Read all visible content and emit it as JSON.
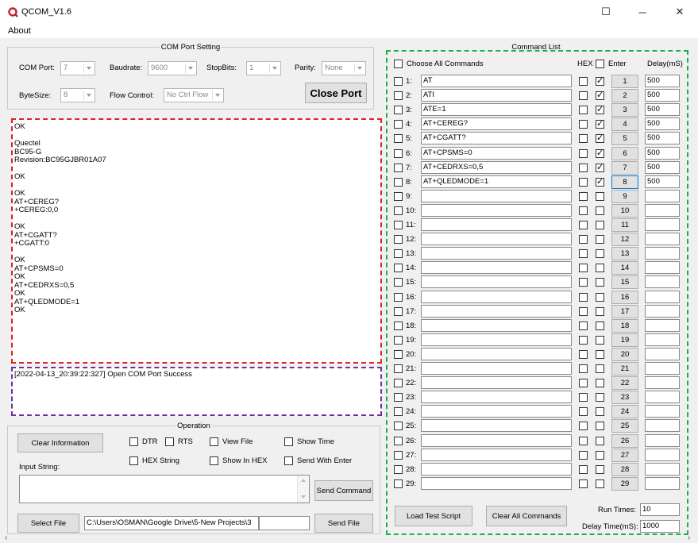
{
  "window": {
    "title": "QCOM_V1.6",
    "minimize": "─",
    "maximize": "☐",
    "close": "✕"
  },
  "menu": {
    "about": "About"
  },
  "com_port": {
    "legend": "COM Port Setting",
    "com_port_label": "COM Port:",
    "com_port_value": "7",
    "baudrate_label": "Baudrate:",
    "baudrate_value": "9600",
    "stopbits_label": "StopBits:",
    "stopbits_value": "1",
    "parity_label": "Parity:",
    "parity_value": "None",
    "bytesize_label": "ByteSize:",
    "bytesize_value": "8",
    "flow_label": "Flow Control:",
    "flow_value": "No Ctrl Flow",
    "close_port": "Close Port"
  },
  "receive_log": "OK\n\nQuectel\nBC95-G\nRevision:BC95GJBR01A07\n\nOK\n\nOK\nAT+CEREG?\n+CEREG:0,0\n\nOK\nAT+CGATT?\n+CGATT:0\n\nOK\nAT+CPSMS=0\nOK\nAT+CEDRXS=0,5\nOK\nAT+QLEDMODE=1\nOK",
  "status_log": "[2022-04-13_20:39:22:327] Open COM Port Success",
  "operation": {
    "legend": "Operation",
    "clear_info": "Clear Information",
    "dtr": "DTR",
    "rts": "RTS",
    "view_file": "View File",
    "show_time": "Show Time",
    "hex_string": "HEX String",
    "show_in_hex": "Show In HEX",
    "send_with_enter": "Send With Enter",
    "input_label": "Input String:",
    "input_value": "",
    "send_command": "Send Command",
    "select_file": "Select File",
    "file_path": "C:\\Users\\OSMAN\\Google Drive\\5-New Projects\\3",
    "send_file": "Send File"
  },
  "commands": {
    "legend": "Command List",
    "choose_all": "Choose All Commands",
    "hex_header": "HEX",
    "enter_header": "Enter",
    "delay_header": "Delay(mS)",
    "rows": [
      {
        "num": "1:",
        "cmd": "AT",
        "enter": true,
        "btn": "1",
        "delay": "500"
      },
      {
        "num": "2:",
        "cmd": "ATI",
        "enter": true,
        "btn": "2",
        "delay": "500"
      },
      {
        "num": "3:",
        "cmd": "ATE=1",
        "enter": true,
        "btn": "3",
        "delay": "500"
      },
      {
        "num": "4:",
        "cmd": "AT+CEREG?",
        "enter": true,
        "btn": "4",
        "delay": "500"
      },
      {
        "num": "5:",
        "cmd": "AT+CGATT?",
        "enter": true,
        "btn": "5",
        "delay": "500"
      },
      {
        "num": "6:",
        "cmd": "AT+CPSMS=0",
        "enter": true,
        "btn": "6",
        "delay": "500"
      },
      {
        "num": "7:",
        "cmd": "AT+CEDRXS=0,5",
        "enter": true,
        "btn": "7",
        "delay": "500"
      },
      {
        "num": "8:",
        "cmd": "AT+QLEDMODE=1",
        "enter": true,
        "btn": "8",
        "delay": "500"
      },
      {
        "num": "9:",
        "cmd": "",
        "enter": false,
        "btn": "9",
        "delay": ""
      },
      {
        "num": "10:",
        "cmd": "",
        "enter": false,
        "btn": "10",
        "delay": ""
      },
      {
        "num": "11:",
        "cmd": "",
        "enter": false,
        "btn": "11",
        "delay": ""
      },
      {
        "num": "12:",
        "cmd": "",
        "enter": false,
        "btn": "12",
        "delay": ""
      },
      {
        "num": "13:",
        "cmd": "",
        "enter": false,
        "btn": "13",
        "delay": ""
      },
      {
        "num": "14:",
        "cmd": "",
        "enter": false,
        "btn": "14",
        "delay": ""
      },
      {
        "num": "15:",
        "cmd": "",
        "enter": false,
        "btn": "15",
        "delay": ""
      },
      {
        "num": "16:",
        "cmd": "",
        "enter": false,
        "btn": "16",
        "delay": ""
      },
      {
        "num": "17:",
        "cmd": "",
        "enter": false,
        "btn": "17",
        "delay": ""
      },
      {
        "num": "18:",
        "cmd": "",
        "enter": false,
        "btn": "18",
        "delay": ""
      },
      {
        "num": "19:",
        "cmd": "",
        "enter": false,
        "btn": "19",
        "delay": ""
      },
      {
        "num": "20:",
        "cmd": "",
        "enter": false,
        "btn": "20",
        "delay": ""
      },
      {
        "num": "21:",
        "cmd": "",
        "enter": false,
        "btn": "21",
        "delay": ""
      },
      {
        "num": "22:",
        "cmd": "",
        "enter": false,
        "btn": "22",
        "delay": ""
      },
      {
        "num": "23:",
        "cmd": "",
        "enter": false,
        "btn": "23",
        "delay": ""
      },
      {
        "num": "24:",
        "cmd": "",
        "enter": false,
        "btn": "24",
        "delay": ""
      },
      {
        "num": "25:",
        "cmd": "",
        "enter": false,
        "btn": "25",
        "delay": ""
      },
      {
        "num": "26:",
        "cmd": "",
        "enter": false,
        "btn": "26",
        "delay": ""
      },
      {
        "num": "27:",
        "cmd": "",
        "enter": false,
        "btn": "27",
        "delay": ""
      },
      {
        "num": "28:",
        "cmd": "",
        "enter": false,
        "btn": "28",
        "delay": ""
      },
      {
        "num": "29:",
        "cmd": "",
        "enter": false,
        "btn": "29",
        "delay": ""
      }
    ],
    "load_script": "Load Test Script",
    "clear_all": "Clear All Commands",
    "run_times_label": "Run Times:",
    "run_times_value": "10",
    "delay_time_label": "Delay Time(mS):",
    "delay_time_value": "1000"
  },
  "colors": {
    "receive_border": "#e02020",
    "status_border": "#7030a0",
    "command_border": "#18b14a"
  }
}
